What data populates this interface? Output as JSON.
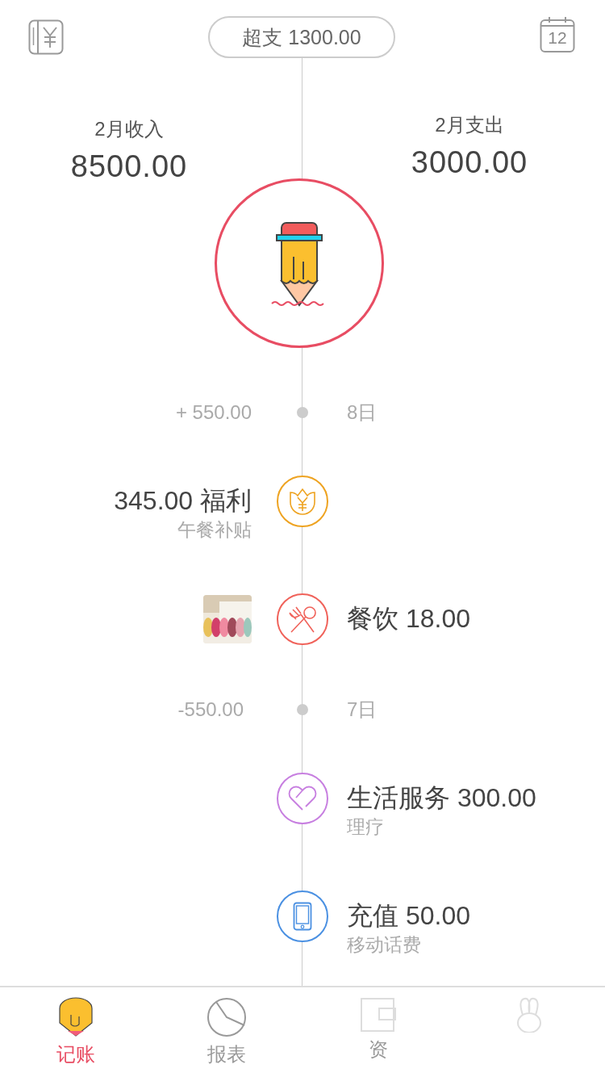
{
  "header": {
    "overspend": "超支 1300.00",
    "calendar_day": "12"
  },
  "summary": {
    "income_label": "2月收入",
    "income": "8500.00",
    "expense_label": "2月支出",
    "expense": "3000.00"
  },
  "timeline": [
    {
      "kind": "date",
      "amount": "+ 550.00",
      "date": "8日"
    },
    {
      "kind": "income",
      "color": "#eea321",
      "title": "345.00 福利",
      "note": "午餐补贴"
    },
    {
      "kind": "expense",
      "color": "#f0625a",
      "title": "餐饮 18.00"
    },
    {
      "kind": "date",
      "amount": "-550.00",
      "date": "7日"
    },
    {
      "kind": "expense",
      "color": "#c77fe0",
      "title": "生活服务 300.00",
      "note": "理疗"
    },
    {
      "kind": "expense",
      "color": "#4a90e2",
      "title": "充值 50.00",
      "note": "移动话费"
    }
  ],
  "tabs": [
    {
      "label": "记账",
      "selected": true
    },
    {
      "label": "报表",
      "selected": false
    },
    {
      "label": "资",
      "selected": false
    },
    {
      "selected": false
    }
  ]
}
